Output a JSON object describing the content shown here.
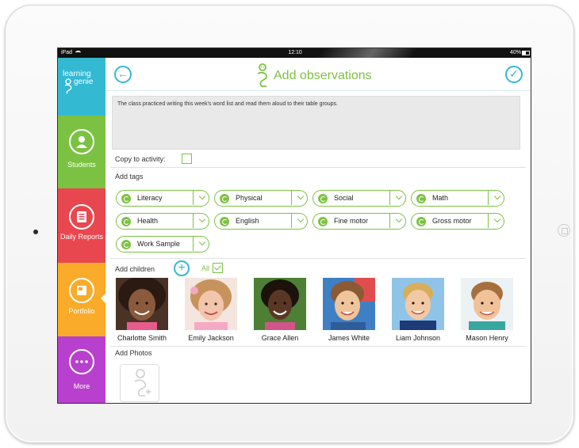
{
  "status_bar": {
    "carrier": "iPad",
    "time": "12:10",
    "battery": "40%"
  },
  "sidebar": {
    "logo_line1": "learning",
    "logo_line2": "genie",
    "items": [
      {
        "label": "Students",
        "color": "#7cc242",
        "icon": "person-icon"
      },
      {
        "label": "Daily Reports",
        "color": "#e9474f",
        "icon": "report-icon"
      },
      {
        "label": "Portfolio",
        "color": "#f9ab29",
        "icon": "portfolio-icon",
        "active": true
      },
      {
        "label": "More",
        "color": "#b93fcf",
        "icon": "more-icon"
      }
    ]
  },
  "header": {
    "title": "Add observations"
  },
  "notes": {
    "text": "The class practiced writing this week's word list and read them aloud to their table groups."
  },
  "copy_to_activity": {
    "label": "Copy to activity:",
    "checked": false
  },
  "tags": {
    "label": "Add tags",
    "items": [
      "Literacy",
      "Physical",
      "Social",
      "Math",
      "Health",
      "English",
      "Fine motor",
      "Gross motor",
      "Work Sample"
    ]
  },
  "children": {
    "label": "Add children",
    "all_label": "All",
    "all_checked": true,
    "items": [
      {
        "name": "Charlotte Smith"
      },
      {
        "name": "Emily Jackson"
      },
      {
        "name": "Grace Allen"
      },
      {
        "name": "James White"
      },
      {
        "name": "Liam Johnson"
      },
      {
        "name": "Mason Henry"
      }
    ]
  },
  "photos": {
    "label": "Add Photos"
  },
  "colors": {
    "accent_blue": "#36b8d2",
    "accent_green": "#7cc242"
  }
}
